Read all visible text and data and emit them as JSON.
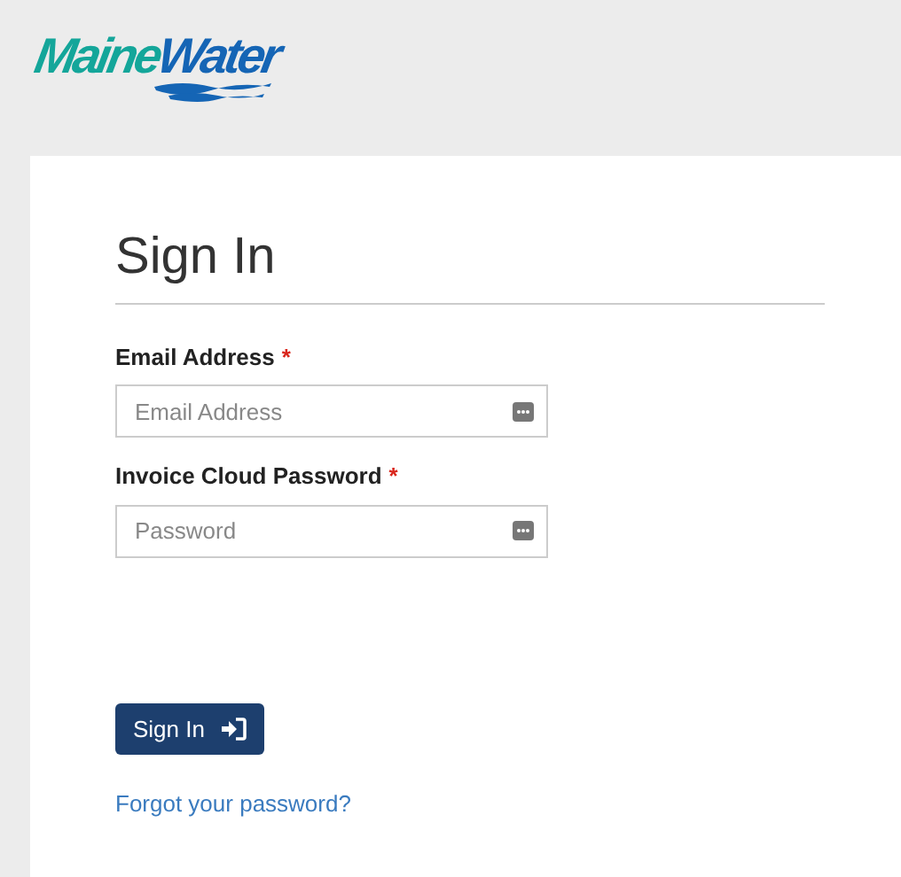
{
  "logo": {
    "part_1": "Maine",
    "part_2": "Water"
  },
  "heading": "Sign In",
  "fields": [
    {
      "label": "Email Address",
      "required_mark": "*",
      "placeholder": "Email Address"
    },
    {
      "label": "Invoice Cloud Password",
      "required_mark": "*",
      "placeholder": "Password"
    }
  ],
  "submit_button": "Sign In",
  "forgot_link": "Forgot your password?"
}
